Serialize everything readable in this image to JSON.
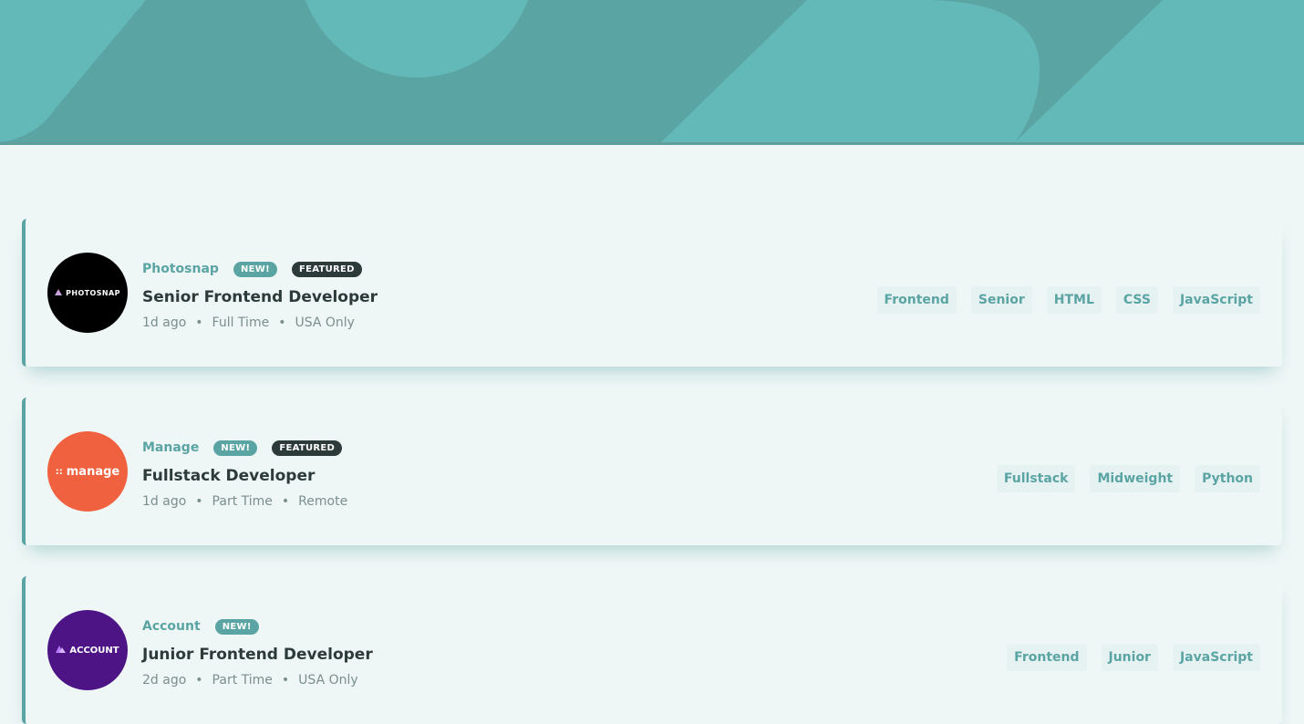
{
  "colors": {
    "primary": "#5ba4a4",
    "background": "#eff6f6",
    "tag_bg": "#e6f2f2",
    "dark": "#2c3a3a",
    "muted": "#7b8e8e"
  },
  "jobs": [
    {
      "company": "Photosnap",
      "logo_text": "PHOTOSNAP",
      "logo_color": "#000000",
      "new": "NEW!",
      "featured": "FEATURED",
      "position": "Senior Frontend Developer",
      "posted": "1d ago",
      "contract": "Full Time",
      "location": "USA Only",
      "tags": [
        "Frontend",
        "Senior",
        "HTML",
        "CSS",
        "JavaScript"
      ]
    },
    {
      "company": "Manage",
      "logo_text": "manage",
      "logo_color": "#f0613f",
      "new": "NEW!",
      "featured": "FEATURED",
      "position": "Fullstack Developer",
      "posted": "1d ago",
      "contract": "Part Time",
      "location": "Remote",
      "tags": [
        "Fullstack",
        "Midweight",
        "Python"
      ]
    },
    {
      "company": "Account",
      "logo_text": "ACCOUNT",
      "logo_color": "#4d1486",
      "new": "NEW!",
      "featured": "",
      "position": "Junior Frontend Developer",
      "posted": "2d ago",
      "contract": "Part Time",
      "location": "USA Only",
      "tags": [
        "Frontend",
        "Junior",
        "JavaScript"
      ]
    }
  ]
}
